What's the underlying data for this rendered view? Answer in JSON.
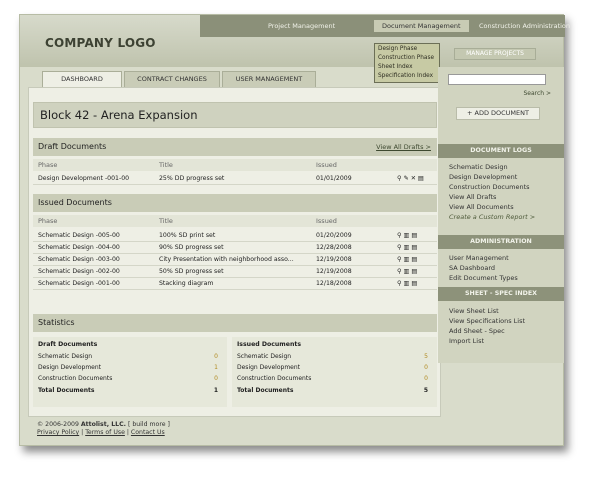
{
  "logo": "COMPANY LOGO",
  "topnav": [
    "Project Management",
    "Document Management",
    "Construction Administration"
  ],
  "dropdown": [
    "Design Phase",
    "Construction Phase",
    "Sheet Index",
    "Specification Index"
  ],
  "manage_label": "MANAGE PROJECTS",
  "tabs": [
    "DASHBOARD",
    "CONTRACT CHANGES",
    "USER MANAGEMENT"
  ],
  "project_title": "Block 42 - Arena Expansion",
  "draft": {
    "title": "Draft Documents",
    "view_all": "View All Drafts >",
    "cols": [
      "Phase",
      "Title",
      "Issued"
    ],
    "rows": [
      {
        "phase": "Design Development -001-00",
        "title": "25% DD progress set",
        "issued": "01/01/2009"
      }
    ]
  },
  "issued": {
    "title": "Issued Documents",
    "cols": [
      "Phase",
      "Title",
      "Issued"
    ],
    "rows": [
      {
        "phase": "Schematic Design -005-00",
        "title": "100% SD print set",
        "issued": "01/20/2009"
      },
      {
        "phase": "Schematic Design -004-00",
        "title": "90% SD progress set",
        "issued": "12/28/2008"
      },
      {
        "phase": "Schematic Design -003-00",
        "title": "City Presentation with neighborhood asso...",
        "issued": "12/19/2008"
      },
      {
        "phase": "Schematic Design -002-00",
        "title": "50% SD progress set",
        "issued": "12/19/2008"
      },
      {
        "phase": "Schematic Design -001-00",
        "title": "Stacking diagram",
        "issued": "12/18/2008"
      }
    ]
  },
  "statistics": {
    "title": "Statistics",
    "draft": {
      "title": "Draft Documents",
      "rows": [
        {
          "label": "Schematic Design",
          "value": "0"
        },
        {
          "label": "Design Development",
          "value": "1"
        },
        {
          "label": "Construction Documents",
          "value": "0"
        },
        {
          "label": "Total Documents",
          "value": "1"
        }
      ]
    },
    "issued": {
      "title": "Issued Documents",
      "rows": [
        {
          "label": "Schematic Design",
          "value": "5"
        },
        {
          "label": "Design Development",
          "value": "0"
        },
        {
          "label": "Construction Documents",
          "value": "0"
        },
        {
          "label": "Total Documents",
          "value": "5"
        }
      ]
    }
  },
  "footer": {
    "copyright": "© 2006-2009",
    "company": "Attolist, LLC.",
    "build": "[ build more ]",
    "links": [
      "Privacy Policy",
      "Terms of Use",
      "Contact Us"
    ]
  },
  "sidebar": {
    "search_label": "Search >",
    "add_doc": "+ ADD DOCUMENT",
    "doclogs_title": "DOCUMENT LOGS",
    "doclogs": [
      "Schematic Design",
      "Design Development",
      "Construction Documents",
      "View All Drafts",
      "View All Documents"
    ],
    "custom_report": "Create a Custom Report >",
    "admin_title": "ADMINISTRATION",
    "admin": [
      "User Management",
      "SA Dashboard",
      "Edit Document Types"
    ],
    "sheet_title": "SHEET - SPEC INDEX",
    "sheet": [
      "View Sheet List",
      "View Specifications List",
      "Add Sheet - Spec",
      "Import List"
    ]
  }
}
